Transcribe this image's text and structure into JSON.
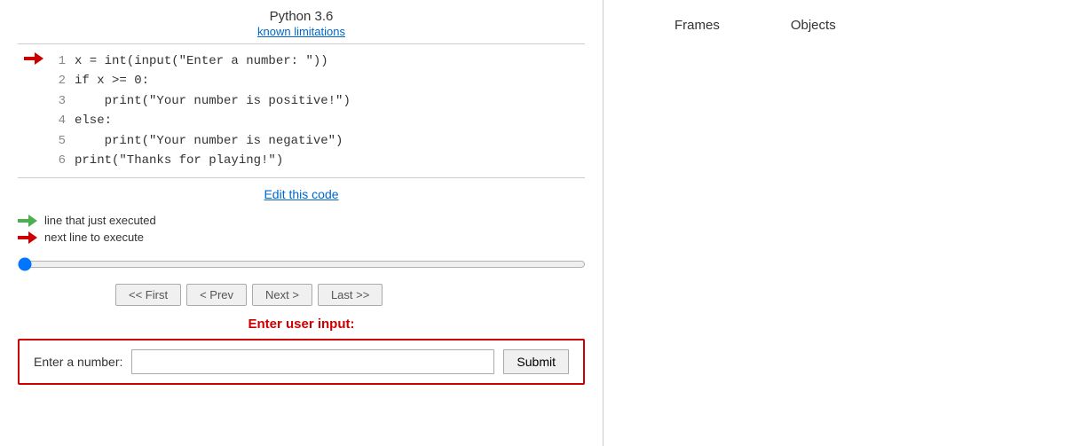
{
  "header": {
    "title": "Python 3.6",
    "known_limitations": "known limitations",
    "frames_label": "Frames",
    "objects_label": "Objects"
  },
  "code": {
    "lines": [
      {
        "num": 1,
        "text": "x = int(input(\"Enter a number: \"))",
        "arrow": "red"
      },
      {
        "num": 2,
        "text": "if x >= 0:",
        "arrow": "none"
      },
      {
        "num": 3,
        "text": "    print(\"Your number is positive!\")",
        "arrow": "none"
      },
      {
        "num": 4,
        "text": "else:",
        "arrow": "none"
      },
      {
        "num": 5,
        "text": "    print(\"Your number is negative\")",
        "arrow": "none"
      },
      {
        "num": 6,
        "text": "print(\"Thanks for playing!\")",
        "arrow": "none"
      }
    ],
    "edit_link": "Edit this code"
  },
  "legend": {
    "green_label": "line that just executed",
    "red_label": "next line to execute"
  },
  "nav": {
    "first": "<< First",
    "prev": "< Prev",
    "next": "Next >",
    "last": "Last >>"
  },
  "user_input": {
    "label": "Enter user input:",
    "field_label": "Enter a number:",
    "placeholder": "",
    "submit": "Submit"
  }
}
